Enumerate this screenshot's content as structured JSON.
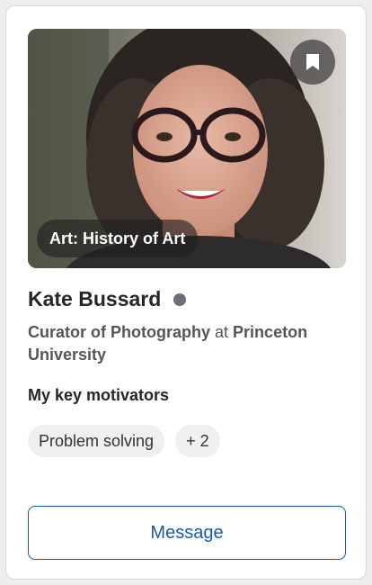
{
  "profile": {
    "topic": "Art: History of Art",
    "name": "Kate Bussard",
    "status_color": "#6b6e78",
    "role_title": "Curator of Photography",
    "role_connector": "at",
    "organization": "Princeton University"
  },
  "motivators": {
    "title": "My key motivators",
    "chips": [
      "Problem solving"
    ],
    "more": "+ 2"
  },
  "actions": {
    "message_label": "Message",
    "bookmark_icon": "bookmark-icon"
  },
  "colors": {
    "accent": "#1a5aa6",
    "card_background": "#ffffff",
    "page_background": "#eeeeef"
  }
}
